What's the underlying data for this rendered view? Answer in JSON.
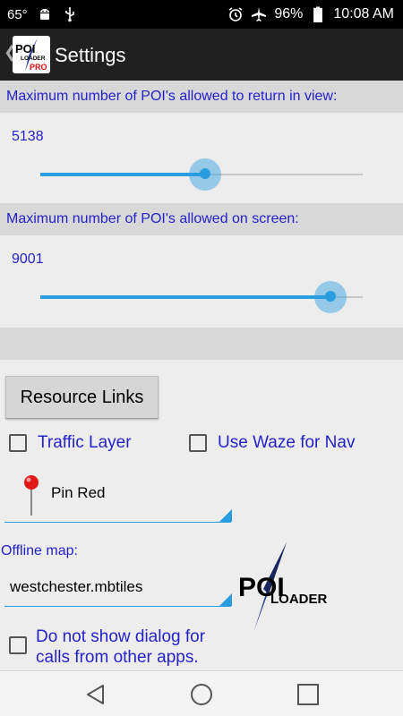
{
  "status_bar": {
    "temperature": "65°",
    "battery": "96%",
    "time": "10:08 AM",
    "icons": [
      "android-icon",
      "usb-icon",
      "alarm-icon",
      "airplane-icon",
      "battery-icon"
    ]
  },
  "action_bar": {
    "title": "Settings",
    "logo_text_top": "POI",
    "logo_text_mid": "LOADER",
    "logo_text_pro": "PRO"
  },
  "settings": {
    "view_limit": {
      "label": "Maximum number of POI's allowed to return in view:",
      "value": "5138",
      "slider_fraction": 0.51
    },
    "screen_limit": {
      "label": "Maximum number of POI's allowed on screen:",
      "value": "9001",
      "slider_fraction": 0.9
    },
    "resource_links_label": "Resource Links",
    "traffic_layer_label": "Traffic Layer",
    "waze_label": "Use Waze for Nav",
    "pin_selection": "Pin Red",
    "offline_map_label": "Offline map:",
    "offline_map_value": "westchester.mbtiles",
    "poi_logo_top": "POI",
    "poi_logo_bottom": "LOADER",
    "no_dialog_label": "Do not show dialog for calls from other apps."
  },
  "colors": {
    "accent": "#2a9de0",
    "label_blue": "#2323c8",
    "header_gray": "#d8d8d8",
    "background": "#ededed"
  }
}
